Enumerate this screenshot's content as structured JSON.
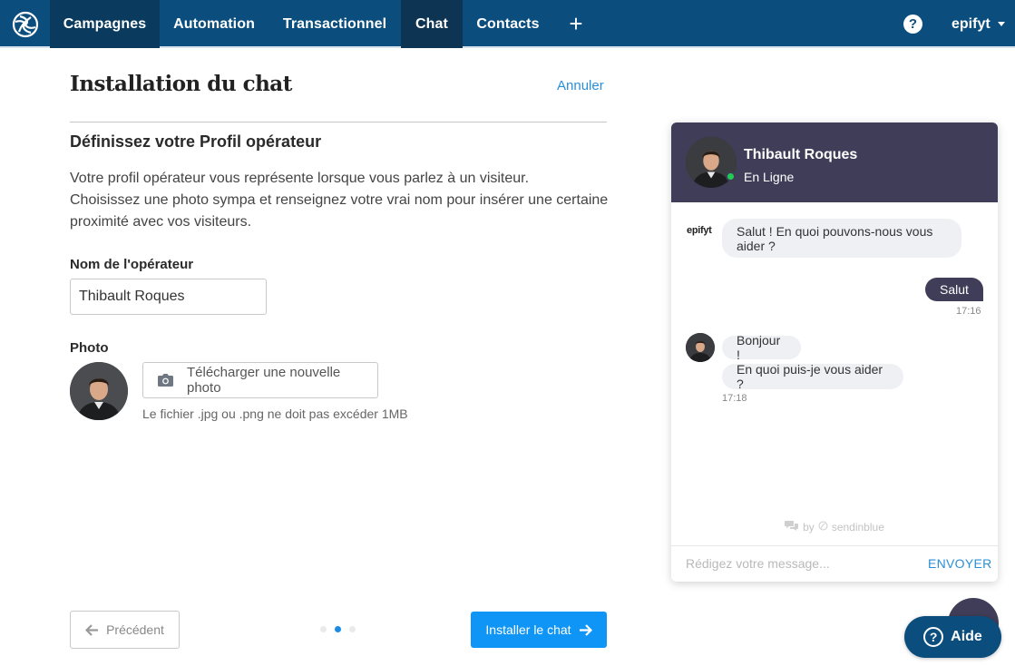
{
  "nav": {
    "items": [
      {
        "label": "Campagnes"
      },
      {
        "label": "Automation"
      },
      {
        "label": "Transactionnel"
      },
      {
        "label": "Chat"
      },
      {
        "label": "Contacts"
      }
    ],
    "plus": "+",
    "help": "?",
    "account": "epifyt"
  },
  "form": {
    "title": "Installation du chat",
    "cancel": "Annuler",
    "section_title": "Définissez votre Profil opérateur",
    "description_line1": "Votre profil opérateur vous représente lorsque vous parlez à un visiteur.",
    "description_line2": "Choisissez une photo sympa et renseignez votre vrai nom pour insérer une certaine proximité avec vos visiteurs.",
    "name_label": "Nom de l'opérateur",
    "name_value": "Thibault Roques",
    "photo_label": "Photo",
    "upload_label": "Télécharger une nouvelle photo",
    "upload_hint": "Le fichier .jpg ou .png ne doit pas excéder 1MB",
    "prev_label": "Précédent",
    "install_label": "Installer le chat",
    "step": {
      "current": 2,
      "total": 3
    }
  },
  "chat_widget": {
    "operator_name": "Thibault Roques",
    "status": "En Ligne",
    "brand": "epifyt",
    "messages": [
      {
        "from": "operator",
        "text": "Salut ! En quoi pouvons-nous vous aider ?"
      },
      {
        "from": "visitor",
        "text": "Salut",
        "time": "17:16"
      },
      {
        "from": "operator",
        "text": "Bonjour !"
      },
      {
        "from": "operator",
        "text": "En quoi puis-je vous aider ?",
        "time": "17:18"
      }
    ],
    "powered_by_prefix": "by",
    "powered_by_brand": "sendinblue",
    "input_placeholder": "Rédigez votre message...",
    "send_label": "ENVOYER"
  },
  "help_button": {
    "label": "Aide",
    "icon": "?"
  },
  "colors": {
    "topbar": "#0b4e7e",
    "accent": "#0f95f5",
    "widget_header": "#403d58",
    "online": "#1fcd51"
  }
}
